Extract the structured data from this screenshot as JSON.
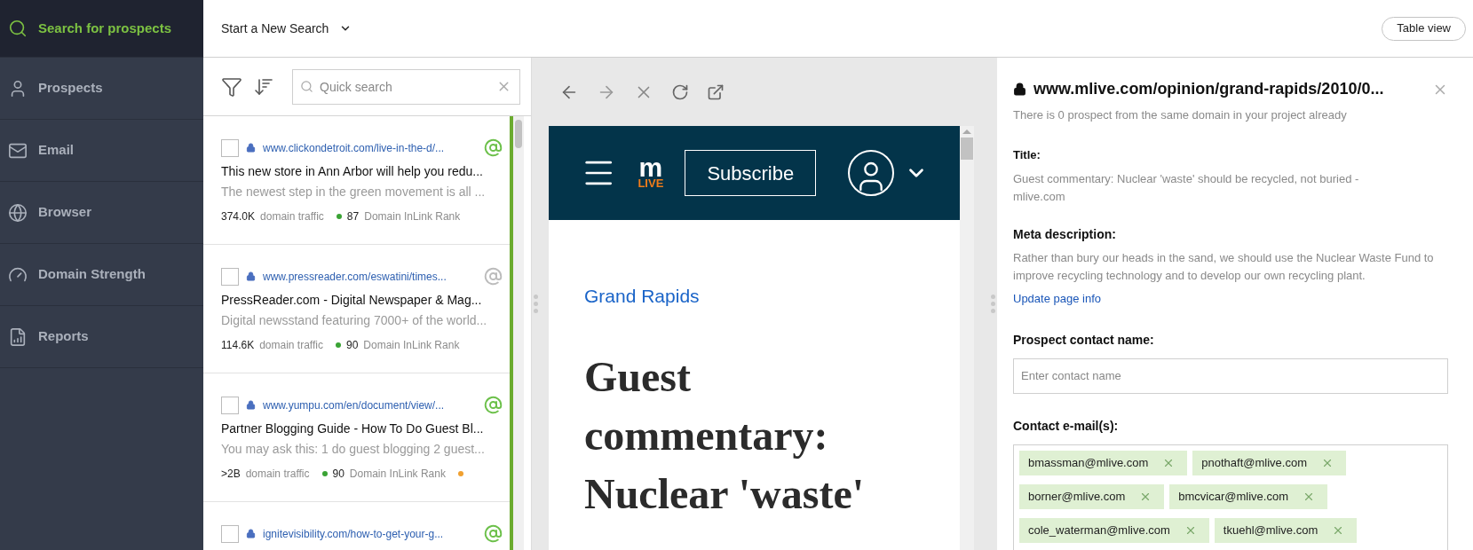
{
  "sidebar": {
    "items": [
      {
        "label": "Search for prospects",
        "selected": true
      },
      {
        "label": "Prospects",
        "selected": false
      },
      {
        "label": "Email",
        "selected": false
      },
      {
        "label": "Browser",
        "selected": false
      },
      {
        "label": "Domain Strength",
        "selected": false
      },
      {
        "label": "Reports",
        "selected": false
      }
    ]
  },
  "top_bar": {
    "search_menu": "Start a New Search",
    "view_button": "Table view"
  },
  "prospect_list": {
    "search": {
      "placeholder": "Quick search"
    },
    "rows": [
      {
        "checked": false,
        "url": "www.clickondetroit.com/live-in-the-d/...",
        "has_email": true,
        "title": "This new store in Ann Arbor will help you redu...",
        "description": "The newest step in the green movement is all ...",
        "metrics": [
          {
            "value": "374.0K",
            "label": "domain traffic"
          },
          {
            "value": "87",
            "label": "Domain InLink Rank",
            "color": "#3aa335"
          }
        ]
      },
      {
        "checked": false,
        "url": "www.pressreader.com/eswatini/times...",
        "has_email": false,
        "title": "PressReader.com - Digital Newspaper & Mag...",
        "description": "Digital newsstand featuring 7000+ of the world...",
        "metrics": [
          {
            "value": "114.6K",
            "label": "domain traffic"
          },
          {
            "value": "90",
            "label": "Domain InLink Rank",
            "color": "#3aa335"
          }
        ]
      },
      {
        "checked": false,
        "url": "www.yumpu.com/en/document/view/...",
        "has_email": true,
        "title": "Partner Blogging Guide - How To Do Guest Bl...",
        "description": "You may ask this: 1 do guest blogging 2 guest...",
        "metrics": [
          {
            "value": ">2B",
            "label": "domain traffic"
          },
          {
            "value": "90",
            "label": "Domain InLink Rank",
            "color": "#3aa335"
          },
          {
            "color": "#f0a030"
          }
        ]
      },
      {
        "checked": false,
        "url": "ignitevisibility.com/how-to-get-your-g...",
        "has_email": true
      }
    ]
  },
  "browser": {
    "page": {
      "subscribe_button": "Subscribe",
      "logo_top": "m",
      "logo_bottom": "LIVE",
      "section": "Grand Rapids",
      "headline": "Guest commentary: Nuclear 'waste'"
    }
  },
  "details": {
    "url": "www.mlive.com/opinion/grand-rapids/2010/0...",
    "note": "There is 0 prospect from the same domain in your project already",
    "title_label": "Title:",
    "title": "Guest commentary: Nuclear 'waste' should be recycled, not buried - mlive.com",
    "meta_label": "Meta description:",
    "meta": "Rather than bury our heads in the sand, we should use the Nuclear Waste Fund to improve recycling technology and to develop our own recycling plant.",
    "update_link": "Update page info",
    "contact_label": "Prospect contact name:",
    "contact": {
      "placeholder": "Enter contact name"
    },
    "emails_label": "Contact e-mail(s):",
    "emails": [
      "bmassman@mlive.com",
      "pnothaft@mlive.com",
      "borner@mlive.com",
      "bmcvicar@mlive.com",
      "cole_waterman@mlive.com",
      "tkuehl@mlive.com"
    ]
  }
}
